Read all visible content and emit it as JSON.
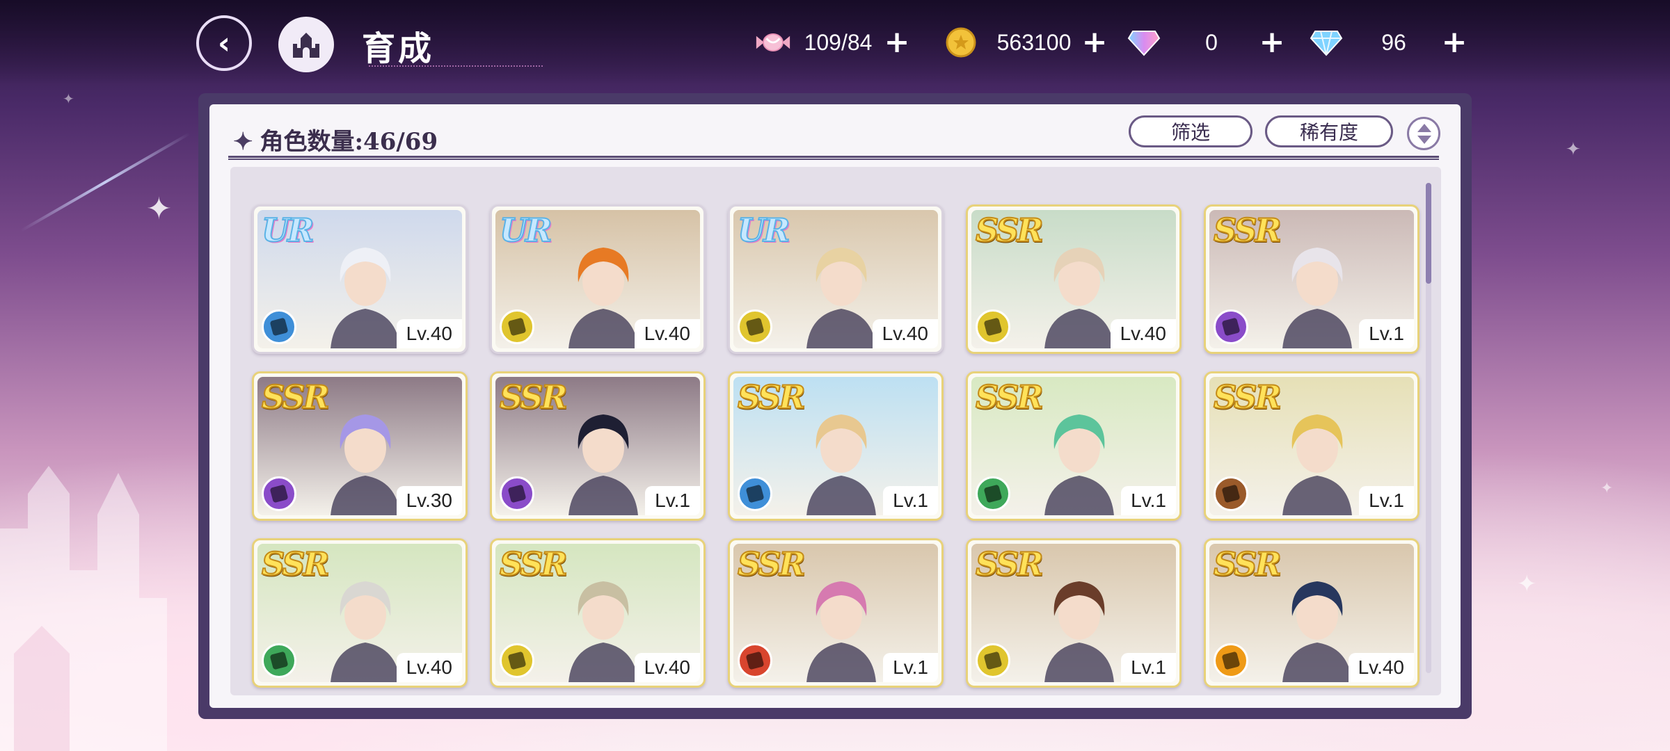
{
  "header": {
    "title": "育成",
    "back_icon": "back-arrow-icon",
    "home_icon": "castle-icon"
  },
  "resources": [
    {
      "name": "candy",
      "icon": "candy-icon",
      "value": "109/84",
      "color": "#f0b0c8"
    },
    {
      "name": "coin",
      "icon": "gold-coin-icon",
      "value": "563100",
      "color": "#f2c23a"
    },
    {
      "name": "rainbow-gem",
      "icon": "rainbow-diamond-icon",
      "value": "0",
      "color": "#b98cf0"
    },
    {
      "name": "diamond",
      "icon": "blue-diamond-icon",
      "value": "96",
      "color": "#7fd3ff"
    }
  ],
  "panel": {
    "count_label": "角色数量:46/69",
    "filter_label": "筛选",
    "rarity_label": "稀有度"
  },
  "cards": [
    {
      "rarity": "UR",
      "level": "Lv.40",
      "attr_color": "#3f8fd8",
      "bg": "#cfd9ec",
      "hair": "#eef0f6"
    },
    {
      "rarity": "UR",
      "level": "Lv.40",
      "attr_color": "#e0c52e",
      "bg": "#d6c2a6",
      "hair": "#e77a24"
    },
    {
      "rarity": "UR",
      "level": "Lv.40",
      "attr_color": "#e0c52e",
      "bg": "#d9c7ad",
      "hair": "#e8d2a2"
    },
    {
      "rarity": "SSR",
      "level": "Lv.40",
      "attr_color": "#e0c52e",
      "bg": "#c8dcc8",
      "hair": "#e6d2b8"
    },
    {
      "rarity": "SSR",
      "level": "Lv.1",
      "attr_color": "#8a4cc9",
      "bg": "#cbb9b6",
      "hair": "#e8e4ea"
    },
    {
      "rarity": "SSR",
      "level": "Lv.30",
      "attr_color": "#8a4cc9",
      "bg": "#8d7a86",
      "hair": "#a597e6"
    },
    {
      "rarity": "SSR",
      "level": "Lv.1",
      "attr_color": "#8a4cc9",
      "bg": "#8d7a86",
      "hair": "#1e1f33"
    },
    {
      "rarity": "SSR",
      "level": "Lv.1",
      "attr_color": "#3f8fd8",
      "bg": "#bde0f2",
      "hair": "#e8c890"
    },
    {
      "rarity": "SSR",
      "level": "Lv.1",
      "attr_color": "#3ea85a",
      "bg": "#d8e9c2",
      "hair": "#5cc49b"
    },
    {
      "rarity": "SSR",
      "level": "Lv.1",
      "attr_color": "#9a5a2a",
      "bg": "#e6e0b6",
      "hair": "#e6c45a"
    },
    {
      "rarity": "SSR",
      "level": "Lv.40",
      "attr_color": "#3ea85a",
      "bg": "#d5e6c0",
      "hair": "#d9d7d2"
    },
    {
      "rarity": "SSR",
      "level": "Lv.40",
      "attr_color": "#e0c52e",
      "bg": "#d5e6c0",
      "hair": "#c8bfa2"
    },
    {
      "rarity": "SSR",
      "level": "Lv.1",
      "attr_color": "#d8452e",
      "bg": "#d9c7ad",
      "hair": "#d67ab0"
    },
    {
      "rarity": "SSR",
      "level": "Lv.1",
      "attr_color": "#e0c52e",
      "bg": "#d9c7ad",
      "hair": "#6a3d2a"
    },
    {
      "rarity": "SSR",
      "level": "Lv.40",
      "attr_color": "#ef9a16",
      "bg": "#d9c7ad",
      "hair": "#27375e"
    }
  ]
}
